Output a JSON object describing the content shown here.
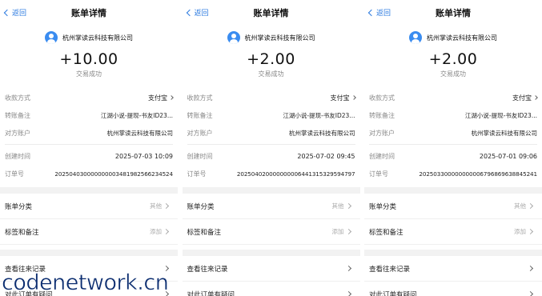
{
  "nav": {
    "back_label": "返回",
    "title": "账单详情"
  },
  "labels": {
    "payment_method": "收款方式",
    "transfer_note": "转账备注",
    "counterparty": "对方账户",
    "created_time": "创建时间",
    "order_no": "订单号",
    "bill_category": "账单分类",
    "tags_notes": "标签和备注",
    "view_history": "查看往来记录",
    "order_question": "对此订单有疑问"
  },
  "screens": [
    {
      "merchant": "杭州掌读云科技有限公司",
      "amount": "+10.00",
      "status": "交易成功",
      "payment_method": "支付宝",
      "transfer_note": "江湖小说-提现-书友ID23...",
      "counterparty": "杭州掌读云科技有限公司",
      "created_time": "2025-07-03 10:09",
      "order_no": "20250403000000000348198256623452​4",
      "category_value": "其他",
      "tags_value": "添加"
    },
    {
      "merchant": "杭州掌读云科技有限公司",
      "amount": "+2.00",
      "status": "交易成功",
      "payment_method": "支付宝",
      "transfer_note": "江湖小说-提现-书友ID23...",
      "counterparty": "杭州掌读云科技有限公司",
      "created_time": "2025-07-02 09:45",
      "order_no": "20250402000000000644131532959​4797",
      "category_value": "其他",
      "tags_value": "添加"
    },
    {
      "merchant": "杭州掌读云科技有限公司",
      "amount": "+2.00",
      "status": "交易成功",
      "payment_method": "支付宝",
      "transfer_note": "江湖小说-提现-书友ID23...",
      "counterparty": "杭州掌读云科技有限公司",
      "created_time": "2025-07-01 09:06",
      "order_no": "20250330000000000679686963884524​1",
      "category_value": "其他",
      "tags_value": "添加"
    }
  ],
  "watermark": "codenetwork.cn",
  "colors": {
    "link_blue": "#2d7be0",
    "avatar_blue": "#3a8cf0",
    "watermark": "#0a2c6f"
  }
}
